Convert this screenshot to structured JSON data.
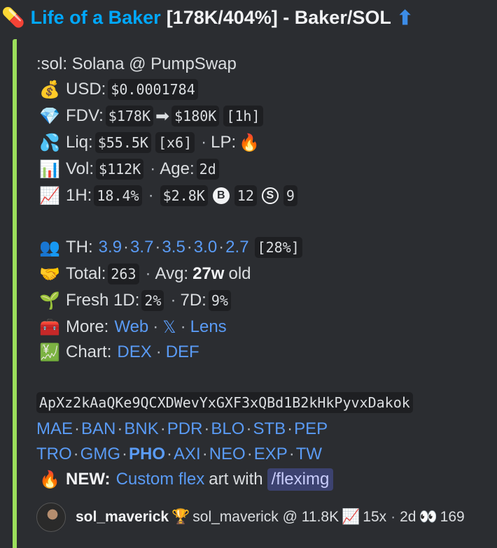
{
  "title": {
    "pill_icon": "pill-emoji",
    "link": "Life of a Baker",
    "rest": "[178K/404%] - Baker/SOL",
    "arrow_icon": "up-arrow-emoji"
  },
  "colors": {
    "accent_bar": "#9cdf5b",
    "link": "#5a9bf5",
    "title_link": "#00a8fc",
    "background": "#2b2d31"
  },
  "lines": {
    "chain": {
      "text": ":sol: Solana @ PumpSwap"
    },
    "usd": {
      "icon": "money-bag-emoji",
      "label": "USD:",
      "value": "$0.0001784"
    },
    "fdv": {
      "icon": "gem-emoji",
      "label": "FDV:",
      "from": "$178K",
      "arrow": "➡",
      "to": "$180K",
      "period": "[1h]"
    },
    "liq": {
      "icon": "sweat-droplets-emoji",
      "label": "Liq:",
      "value": "$55.5K",
      "mult": "[x6]",
      "lp_label": "LP:",
      "lp_icon": "fire-emoji"
    },
    "vol": {
      "icon": "bar-chart-emoji",
      "label": "Vol:",
      "value": "$112K",
      "age_label": "Age:",
      "age": "2d"
    },
    "h1": {
      "icon": "chart-increasing-emoji",
      "label": "1H:",
      "pct": "18.4%",
      "amount": "$2.8K",
      "buy_letter": "B",
      "buys": "12",
      "sell_letter": "S",
      "sells": "9"
    },
    "th": {
      "icon": "busts-emoji",
      "label": "TH:",
      "values": [
        "3.9",
        "3.7",
        "3.5",
        "3.0",
        "2.7"
      ],
      "pct": "[28%]"
    },
    "total": {
      "icon": "handshake-emoji",
      "label": "Total:",
      "value": "263",
      "avg_label": "Avg:",
      "avg": "27w",
      "avg_suffix": "old"
    },
    "fresh": {
      "icon": "seedling-emoji",
      "label": "Fresh 1D:",
      "d1": "2%",
      "d7_label": "7D:",
      "d7": "9%"
    },
    "more": {
      "icon": "toolbox-emoji",
      "label": "More:",
      "web": "Web",
      "x": "𝕏",
      "lens": "Lens"
    },
    "chart": {
      "icon": "yen-chart-emoji",
      "label": "Chart:",
      "dex": "DEX",
      "def": "DEF"
    },
    "address": "ApXz2kAaQKe9QCXDWevYxGXF3xQBd1B2kHkPyvxDakok",
    "row1": [
      "MAE",
      "BAN",
      "BNK",
      "PDR",
      "BLO",
      "STB",
      "PEP"
    ],
    "row2": [
      "TRO",
      "GMG",
      "PHO",
      "AXI",
      "NEO",
      "EXP",
      "TW"
    ],
    "new": {
      "icon": "fire-emoji",
      "label": "NEW:",
      "link": "Custom flex",
      "text": "art with",
      "command": "/fleximg"
    }
  },
  "footer": {
    "avatar": "user-avatar",
    "username": "sol_maverick",
    "trophy_icon": "trophy-emoji",
    "caller": "sol_maverick @ 11.8K",
    "chart_icon": "chart-increasing-emoji",
    "mult": "15x",
    "age": "2d",
    "eyes_icon": "eyes-emoji",
    "views": "169"
  }
}
